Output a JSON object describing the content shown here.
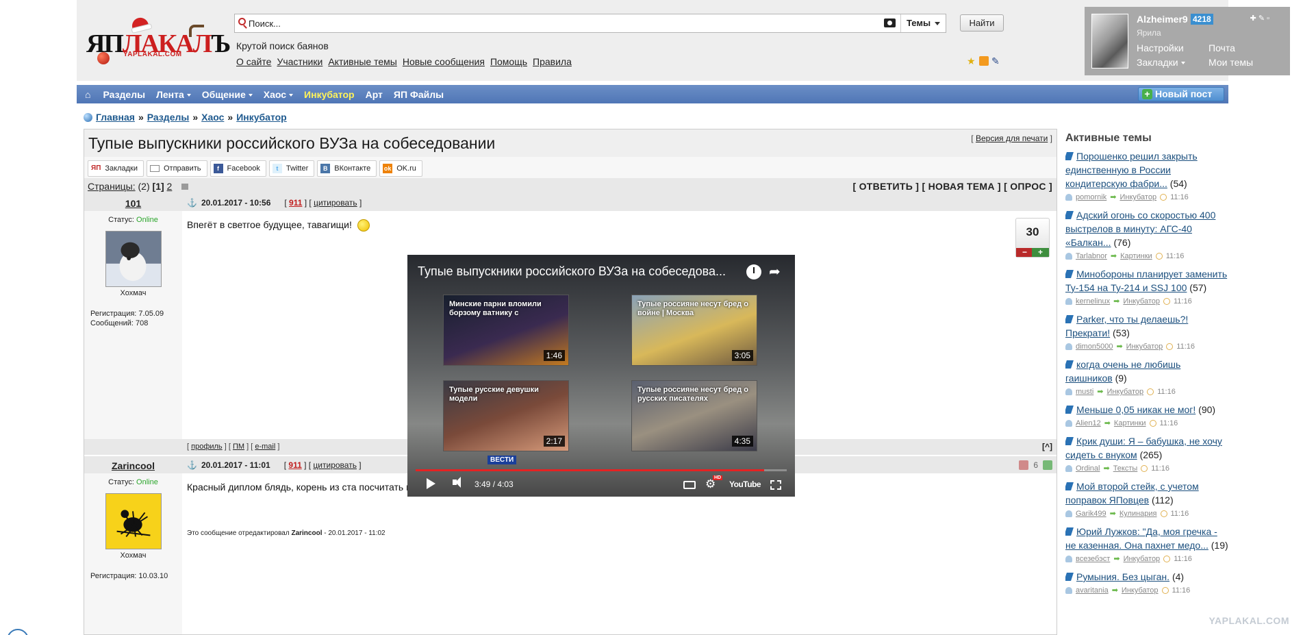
{
  "header": {
    "logo": {
      "word_black": "ЯП",
      "word_red": "ЛАКАЛ",
      "word_tail": "Ъ",
      "domain": "YAPLAKAL.COM"
    },
    "search": {
      "placeholder": "Поиск...",
      "scope_label": "Темы",
      "button_label": "Найти"
    },
    "tagline": "Крутой поиск баянов",
    "links": [
      "О сайте",
      "Участники",
      "Активные темы",
      "Новые сообщения",
      "Помощь",
      "Правила"
    ]
  },
  "user_panel": {
    "username": "Alzheimer9",
    "karma": "4218",
    "rank": "Ярила",
    "links": [
      "Настройки",
      "Почта",
      "Закладки",
      "Мои темы"
    ]
  },
  "nav": {
    "items": [
      {
        "label": "Разделы",
        "caret": false,
        "highlight": false
      },
      {
        "label": "Лента",
        "caret": true,
        "highlight": false
      },
      {
        "label": "Общение",
        "caret": true,
        "highlight": false
      },
      {
        "label": "Хаос",
        "caret": true,
        "highlight": false
      },
      {
        "label": "Инкубатор",
        "caret": false,
        "highlight": true
      },
      {
        "label": "Арт",
        "caret": false,
        "highlight": false
      },
      {
        "label": "ЯП Файлы",
        "caret": false,
        "highlight": false
      }
    ],
    "new_post_label": "Новый пост"
  },
  "breadcrumb": [
    "Главная",
    "Разделы",
    "Хаос",
    "Инкубатор"
  ],
  "topic": {
    "title": "Тупые выпускники российского ВУЗа на собеседовании",
    "print_link": "Версия для печати",
    "share_buttons": [
      "Закладки",
      "Отправить",
      "Facebook",
      "Twitter",
      "ВКонтакте",
      "OK.ru"
    ],
    "share_icon_letters": {
      "yap": "ЯП",
      "fb": "f",
      "tw": "t",
      "vk": "В",
      "ok": "ok"
    },
    "pages_label": "Страницы:",
    "pages_count": "(2)",
    "pages_current": "[1]",
    "pages_next": "2",
    "actions": "[ ОТВЕТИТЬ ] [ НОВАЯ ТЕМА ] [ ОПРОС ]"
  },
  "posts": [
    {
      "author": "101",
      "date": "20.01.2017 - 10:56",
      "n911": "911",
      "quote_label": "цитировать",
      "status_label": "Статус:",
      "status": "Online",
      "group": "Хохмач",
      "registration": "Регистрация: 7.05.09",
      "messages": "Сообщений: 708",
      "text": "Впегёт в светгое будущее, тавагищи!",
      "rating": "30",
      "footer_links": [
        "профиль",
        "ПМ",
        "e-mail"
      ],
      "to_top": "[^]"
    },
    {
      "author": "Zarincool",
      "date": "20.01.2017 - 11:01",
      "n911": "911",
      "quote_label": "цитировать",
      "status_label": "Статус:",
      "status": "Online",
      "group": "Хохмач",
      "registration": "Регистрация: 10.03.10",
      "text": "Красный диплом блядь, корень из ста посчитать не могут",
      "rating": "6",
      "edited_prefix": "Это сообщение отредактировал",
      "edited_by": "Zarincool",
      "edited_at": "- 20.01.2017 - 11:02"
    }
  ],
  "video": {
    "title": "Тупые выпускники российского ВУЗа на собеседова...",
    "time": "3:49 / 4:03",
    "progress": 0.94,
    "channel_badge": "ВЕСТИ",
    "youtube_label": "YouTube",
    "hd_label": "HD",
    "related": [
      {
        "title": "Минские парни вломили борзому ватнику с",
        "duration": "1:46"
      },
      {
        "title": "Тупые россияне несут бред о войне | Москва",
        "duration": "3:05"
      },
      {
        "title": "Тупые русские девушки модели",
        "duration": "2:17"
      },
      {
        "title": "Тупые россияне несут бред о русских писателях",
        "duration": "4:35"
      }
    ]
  },
  "sidebar": {
    "title": "Активные темы",
    "topics": [
      {
        "title": "Порошенко решил закрыть единственную в России кондитерскую фабри...",
        "count": "(54)",
        "author": "pomornik",
        "section": "Инкубатор",
        "time": "11:16"
      },
      {
        "title": "Адский огонь со скоростью 400 выстрелов в минуту: АГС-40 «Балкан...",
        "count": "(76)",
        "author": "Tarlabnor",
        "section": "Картинки",
        "time": "11:16"
      },
      {
        "title": "Минобороны планирует заменить Ту-154 на Ту-214 и SSJ 100",
        "count": "(57)",
        "author": "kernelinux",
        "section": "Инкубатор",
        "time": "11:16"
      },
      {
        "title": "Parker, что ты делаешь?! Прекрати!",
        "count": "(53)",
        "author": "dimon5000",
        "section": "Инкубатор",
        "time": "11:16"
      },
      {
        "title": "когда очень не любишь гаишников",
        "count": "(9)",
        "author": "musti",
        "section": "Инкубатор",
        "time": "11:16"
      },
      {
        "title": "Меньше 0,05 никак не мог!",
        "count": "(90)",
        "author": "Alien12",
        "section": "Картинки",
        "time": "11:16"
      },
      {
        "title": "Крик души: Я – бабушка, не хочу сидеть с внуком",
        "count": "(265)",
        "author": "Ordinal",
        "section": "Тексты",
        "time": "11:16"
      },
      {
        "title": "Мой второй стейк, с учетом поправок ЯПовцев",
        "count": "(112)",
        "author": "Garik499",
        "section": "Кулинария",
        "time": "11:16"
      },
      {
        "title": "Юрий Лужков: \"Да, моя гречка - не казенная. Она пахнет медо...",
        "count": "(19)",
        "author": "всезебэст",
        "section": "Инкубатор",
        "time": "11:16"
      },
      {
        "title": "Румыния. Без цыган.",
        "count": "(4)",
        "author": "avaritania",
        "section": "Инкубатор",
        "time": "11:16"
      }
    ]
  },
  "watermark": "YAPLAKAL.COM"
}
